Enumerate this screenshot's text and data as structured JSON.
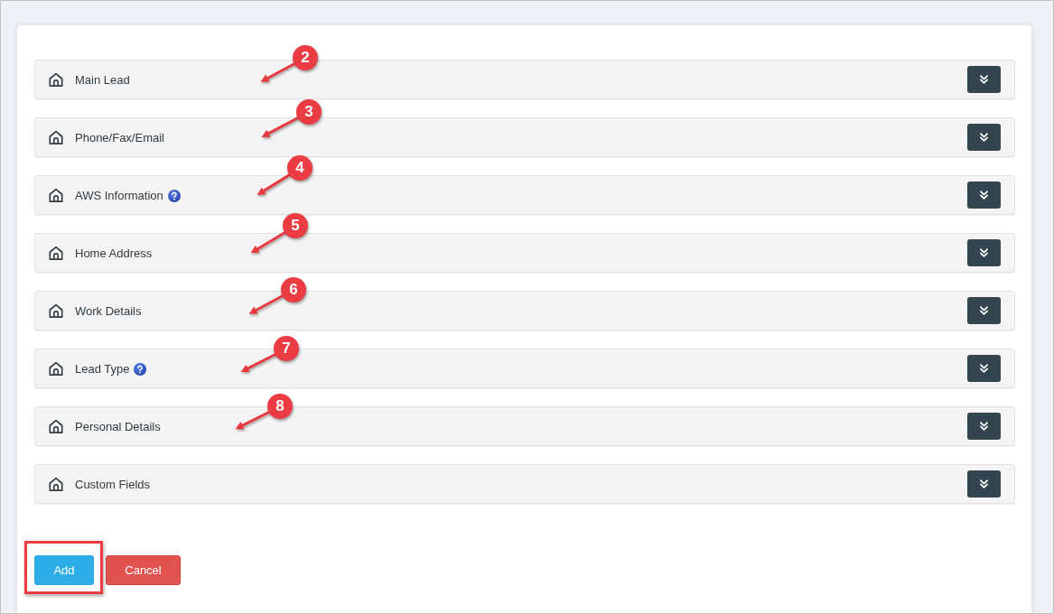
{
  "sections": [
    {
      "title": "Main Lead",
      "help": false,
      "expanded": false,
      "callout": "2"
    },
    {
      "title": "Phone/Fax/Email",
      "help": false,
      "expanded": false,
      "callout": "3"
    },
    {
      "title": "AWS Information",
      "help": true,
      "expanded": false,
      "callout": "4"
    },
    {
      "title": "Home Address",
      "help": false,
      "expanded": false,
      "callout": "5"
    },
    {
      "title": "Work Details",
      "help": false,
      "expanded": false,
      "callout": "6"
    },
    {
      "title": "Lead Type",
      "help": true,
      "expanded": false,
      "callout": "7"
    },
    {
      "title": "Personal Details",
      "help": false,
      "expanded": false,
      "callout": "8"
    },
    {
      "title": "Custom Fields",
      "help": false,
      "expanded": false
    }
  ],
  "buttons": [
    {
      "label": "Add",
      "kind": "primary",
      "highlighted": true
    },
    {
      "label": "Cancel",
      "kind": "danger",
      "highlighted": false
    }
  ]
}
